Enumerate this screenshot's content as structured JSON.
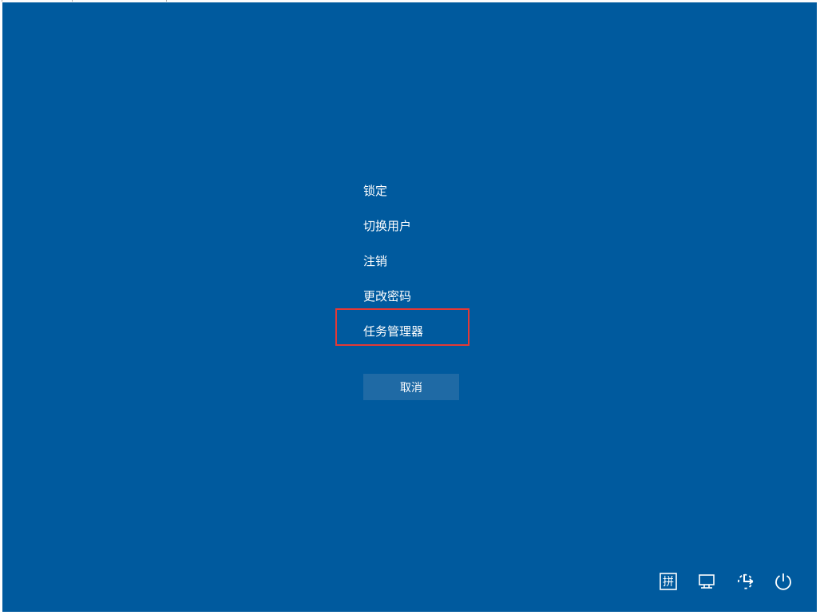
{
  "menu": {
    "lock": "锁定",
    "switch_user": "切换用户",
    "sign_out": "注销",
    "change_password": "更改密码",
    "task_manager": "任务管理器"
  },
  "cancel_button_label": "取消",
  "icons": {
    "ime": "拼",
    "network": "network",
    "ease_of_access": "ease-of-access",
    "power": "power"
  }
}
